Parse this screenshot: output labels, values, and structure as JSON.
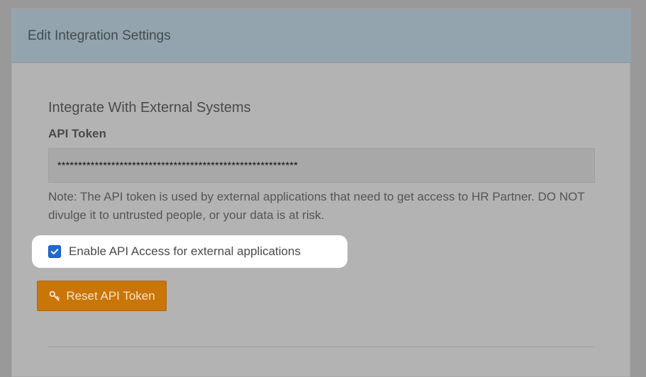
{
  "panel": {
    "title": "Edit Integration Settings"
  },
  "section": {
    "title": "Integrate With External Systems",
    "api_token_label": "API Token",
    "api_token_value": "**********************************************************",
    "note": "Note: The API token is used by external applications that need to get access to HR Partner. DO NOT divulge it to untrusted people, or your data is at risk."
  },
  "checkbox": {
    "label": "Enable API Access for external applications",
    "checked": true
  },
  "button": {
    "reset_label": "Reset API Token",
    "icon": "key-icon"
  },
  "colors": {
    "header": "#93a4ae",
    "button": "#c97508",
    "checkbox": "#1f6ad7",
    "highlight": "#ffffff"
  }
}
